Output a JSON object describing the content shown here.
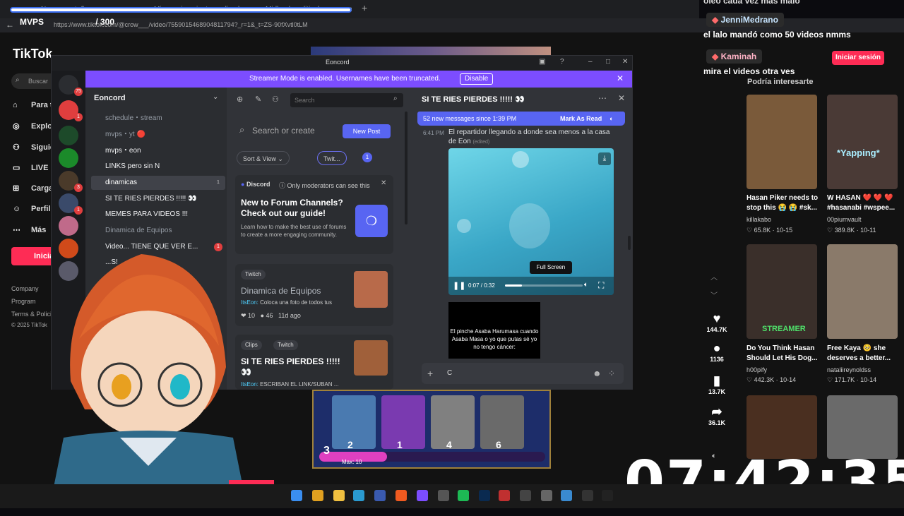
{
  "browser": {
    "tabs": [
      "Nuevo pestaña",
      "Mi maquinamiento explicado",
      "Midlands political movement"
    ],
    "overlay_text": "MVPS ",
    "overlay_count": "/ 300",
    "url": "https://www.tiktok.com/@crow___/video/7559015468904811794?_r=1&_t=ZS-90fXvtl0tLM"
  },
  "tiktok": {
    "logo": "TikTok",
    "search_placeholder": "Buscar",
    "nav": [
      {
        "icon": "home-icon",
        "label": "Para ti"
      },
      {
        "icon": "compass-icon",
        "label": "Explorar"
      },
      {
        "icon": "following-icon",
        "label": "Siguiendo"
      },
      {
        "icon": "live-icon",
        "label": "LIVE"
      },
      {
        "icon": "upload-icon",
        "label": "Cargar"
      },
      {
        "icon": "profile-icon",
        "label": "Perfil"
      },
      {
        "icon": "more-icon",
        "label": "Más"
      }
    ],
    "login_button": "Iniciar",
    "footer": [
      "Company",
      "Program",
      "Terms & Policies",
      "© 2025 TikTok"
    ],
    "header_login": "Iniciar sesión",
    "suggested_heading": "Podría interesarte",
    "actions": [
      {
        "icon": "heart-icon",
        "count": "144.7K"
      },
      {
        "icon": "comment-icon",
        "count": "1136"
      },
      {
        "icon": "bookmark-icon",
        "count": "13.7K"
      },
      {
        "icon": "share-icon",
        "count": "36.1K"
      }
    ],
    "suggestions": [
      {
        "title": "Hasan Piker needs to stop this 😭 😭 #sk...",
        "author": "killakabo",
        "views": "65.8K",
        "date": "10-15",
        "caption": "",
        "color": "#7a5a3a"
      },
      {
        "title": "W HASAN ❤️ ❤️ ❤️ #hasanabi #wspee...",
        "author": "00piumvault",
        "views": "389.8K",
        "date": "10-11",
        "caption": "*Yapping*",
        "color": "#4a3a36"
      },
      {
        "title": "Do You Think Hasan Should Let His Dog...",
        "author": "h00pify",
        "views": "442.3K",
        "date": "10-14",
        "caption": "STREAMER",
        "color": "#3a2f2a"
      },
      {
        "title": "Free Kaya 🥺 she deserves a better...",
        "author": "nataliireynoldss",
        "views": "171.7K",
        "date": "10-14",
        "caption": "",
        "color": "#8a7a6a"
      }
    ]
  },
  "stream_chat": [
    {
      "name": "",
      "message": "oleo cada vez más malo"
    },
    {
      "name": "JenniMedrano",
      "message": "el lalo mandó como 50 videos nmms"
    },
    {
      "name": "Kaminah",
      "message": "mira el videos otra ves"
    }
  ],
  "eoncord": {
    "window_title": "Eoncord",
    "banner_text": "Streamer Mode is enabled. Usernames have been truncated.",
    "banner_button": "Disable",
    "server_name": "Eoncord",
    "channels": [
      {
        "label": "schedule・stream",
        "badge": ""
      },
      {
        "label": "mvps・yt 🔴",
        "badge": ""
      },
      {
        "label": "mvps・eon",
        "badge": ""
      },
      {
        "label": "LINKS pero sin N",
        "badge": ""
      },
      {
        "label": "dinamicas",
        "badge": "1"
      },
      {
        "label": "SI TE RIES PIERDES !!!!! 👀",
        "badge": ""
      },
      {
        "label": "MEMES PARA VIDEOS !!!",
        "badge": ""
      },
      {
        "label": "Dinamica de Equipos",
        "badge": ""
      },
      {
        "label": "Video... TIENE QUE VER E...",
        "badge": "1"
      },
      {
        "label": "...S!",
        "badge": ""
      }
    ],
    "server_badges": [
      "75",
      "1",
      "3",
      "1"
    ],
    "forum": {
      "search_placeholder": "Search",
      "search_or_create": "Search or create",
      "new_post": "New Post",
      "sort_view": "Sort & View",
      "filter_tag": "Twit...",
      "filter_count": "1",
      "notice_label": "Discord",
      "notice_text": "Only moderators can see this",
      "guide_title": "New to Forum Channels? Check out our guide!",
      "guide_body": "Learn how to make the best use of forums to create a more engaging community.",
      "posts": [
        {
          "tags": [
            "Twitch"
          ],
          "title": "Dinamica de Equipos",
          "author": "ItsEon:",
          "preview": "Coloca una foto de todos tus",
          "reactions": "10",
          "comments": "46",
          "time": "11d ago"
        },
        {
          "tags": [
            "Clips",
            "Twitch"
          ],
          "title": "SI TE RIES PIERDES !!!!! 👀",
          "author": "ItsEon:",
          "preview": "ESCRIBAN EL LINK/SUBAN ..."
        }
      ]
    },
    "thread": {
      "title": "SI TE RIES PIERDES !!!!! 👀",
      "new_messages": "52 new messages since 1:39 PM",
      "mark_read": "Mark As Read",
      "timestamp": "6:41 PM",
      "message": "El repartidor llegando a donde sea menos a la casa de Eon",
      "edited": "(edited)",
      "video_time": "0:07 / 0:32",
      "video_progress": 0.22,
      "tooltip": "Full Screen",
      "second_video_text": "El pinche Asaba Harumasa cuando Asaba Masa o yo que putas sé yo no tengo cáncer:",
      "input_value": "C"
    }
  },
  "game": {
    "cards": [
      "2",
      "1",
      "4",
      "6"
    ],
    "elixir": "3",
    "elixir_max": "Max: 10"
  },
  "clock": "07:42:35"
}
